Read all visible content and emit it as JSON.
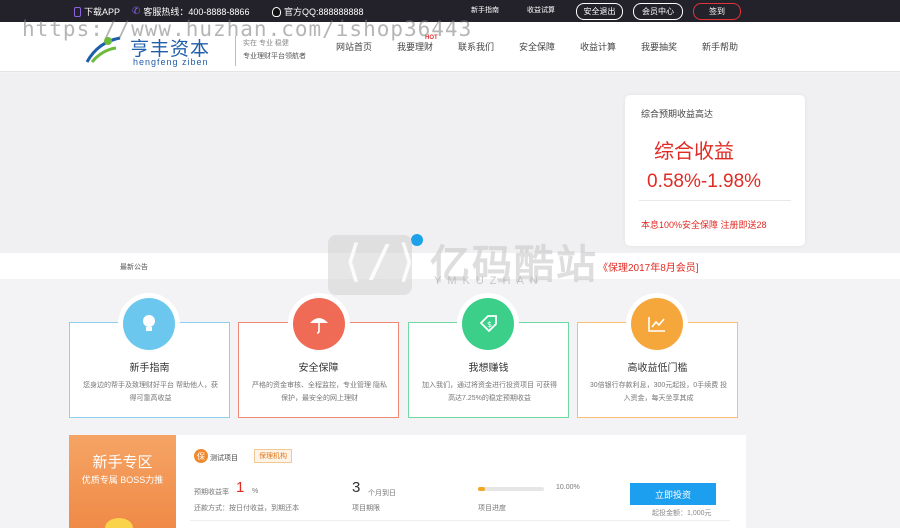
{
  "topbar": {
    "download_app": "下载APP",
    "hotline": "客服热线：400-8888-8866",
    "qq": "官方QQ:888888888",
    "links": [
      "新手指南",
      "收益试算"
    ],
    "btn_logout": "安全退出",
    "btn_member": "会员中心",
    "btn_signin": "签到",
    "colors": {
      "bar": "#23222a",
      "accent_red": "#e0343a",
      "purple": "#8b64e6"
    }
  },
  "watermark_url": "https://www.huzhan.com/ishop36443",
  "logo": {
    "cn": "亨丰资本",
    "en": "hengfeng ziben"
  },
  "slogan": {
    "line1": "实在 专业 稳健",
    "line2": "专业理财平台领航者"
  },
  "nav": {
    "items": [
      "网站首页",
      "我要理财",
      "联系我们",
      "安全保障",
      "收益计算",
      "我要抽奖",
      "新手帮助"
    ],
    "hot": "HOT"
  },
  "banner_card": {
    "title": "综合预期收益高达",
    "big": "综合收益",
    "rate": "0.58%-1.98%",
    "foot": "本息100%安全保障 注册即送28",
    "accent": "#e02b24"
  },
  "notice": {
    "label": "最新公告",
    "text": "《保理2017年8月会员]"
  },
  "center_watermark": {
    "cn": "亿码酷站",
    "en": "YMKUZHAN",
    "code": "⟨/⟩"
  },
  "features": [
    {
      "title": "新手指南",
      "desc": "您身边的帮手及致理财好平台 帮助他人，获得可靠高收益",
      "icon": "lightbulb-icon",
      "color": "#6cc7ef",
      "border": "#8fd0f0"
    },
    {
      "title": "安全保障",
      "desc": "严格的资金审核、全程监控，专业管理 隐私保护，最安全的网上理财",
      "icon": "umbrella-icon",
      "color": "#f06b55",
      "border": "#f08a77"
    },
    {
      "title": "我想赚钱",
      "desc": "加入我们，通过将资金进行投资项目 可获得高达7.25%的稳定预期收益",
      "icon": "money-tag-icon",
      "color": "#3ccf8a",
      "border": "#72d8a2"
    },
    {
      "title": "高收益低门槛",
      "desc": "30倍银行存款利息，300元起投，0手续费 投入资金，每天坐享其成",
      "icon": "chart-up-icon",
      "color": "#f6a73b",
      "border": "#f7bf71"
    }
  ],
  "promo": {
    "title": "新手专区",
    "subtitle": "优质专属 BOSS力推"
  },
  "product": {
    "badge": "保",
    "name": "测试项目",
    "tag": "保理机构",
    "rate_label": "预期收益率",
    "rate_value": "1",
    "rate_unit": "%",
    "repay": "还款方式：按日付收益，到期还本",
    "term_value": "3",
    "term_unit": "个月到日",
    "term_label": "项目期限",
    "progress_pct": 10,
    "progress_text": "10.00%",
    "progress_label": "项目进度",
    "invest_label": "立即投资",
    "min_amount": "起投金额：1,000元"
  }
}
